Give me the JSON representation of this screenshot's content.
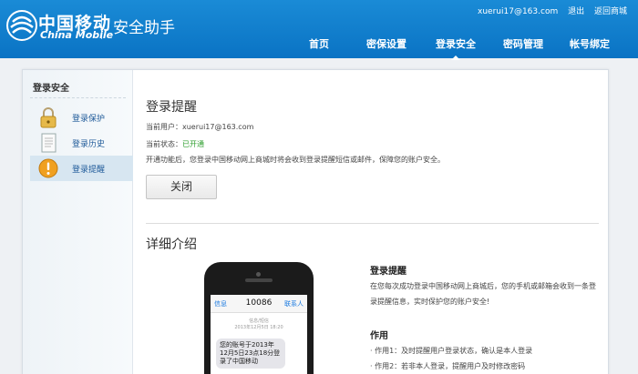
{
  "header": {
    "brand_cn": "中国移动",
    "brand_en": "China Mobile",
    "app_title": "安全助手",
    "user_email": "xuerui17@163.com",
    "logout": "退出",
    "back_to_mall": "返回商城",
    "nav": [
      {
        "label": "首页"
      },
      {
        "label": "密保设置"
      },
      {
        "label": "登录安全"
      },
      {
        "label": "密码管理"
      },
      {
        "label": "帐号绑定"
      }
    ]
  },
  "sidebar": {
    "title": "登录安全",
    "items": [
      {
        "label": "登录保护",
        "icon": "lock-icon"
      },
      {
        "label": "登录历史",
        "icon": "document-icon"
      },
      {
        "label": "登录提醒",
        "icon": "alert-icon"
      }
    ]
  },
  "content": {
    "title": "登录提醒",
    "current_user_label": "当前用户：",
    "current_user_value": "xuerui17@163.com",
    "status_label": "当前状态：",
    "status_value": "已开通",
    "description": "开通功能后，您登录中国移动网上商城时将会收到登录提醒短信或邮件，保障您的账户安全。",
    "close_button": "关闭",
    "detail_title": "详细介绍"
  },
  "phone": {
    "back": "信息",
    "number": "10086",
    "contact": "联系人",
    "meta_line1": "信息/短信",
    "meta_line2": "2013年12月5日 18:20",
    "message": "您的账号于2013年12月5日23点18分登录了中国移动"
  },
  "detail": {
    "heading1": "登录提醒",
    "para1": "在您每次成功登录中国移动网上商城后，您的手机或邮箱会收到一条登录提醒信息，实时保护您的账户安全!",
    "heading2": "作用",
    "uses": [
      "· 作用1：及时提醒用户登录状态，确认是本人登录",
      "· 作用2：若非本人登录，提醒用户及时修改密码"
    ]
  },
  "colors": {
    "header_blue": "#0a73c4",
    "status_green": "#2e9e2e",
    "sidebar_active": "#d7e6f1"
  }
}
